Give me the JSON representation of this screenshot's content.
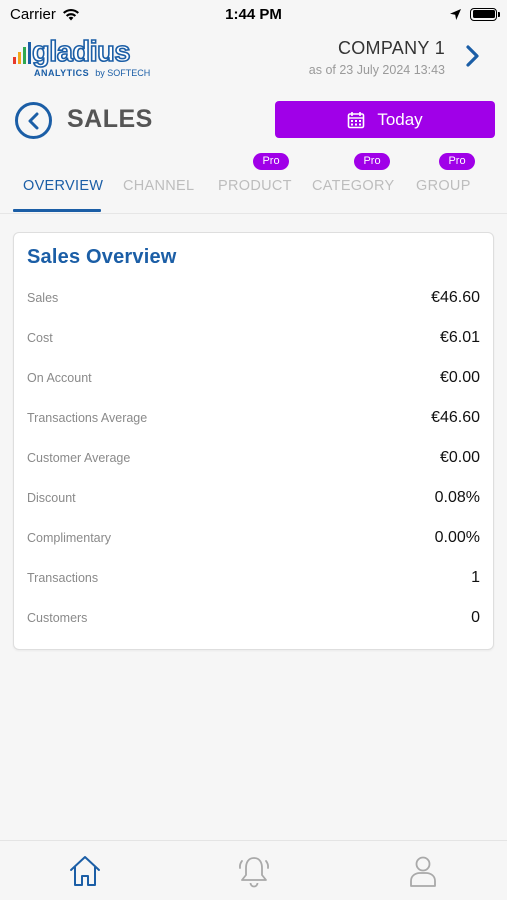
{
  "status_bar": {
    "carrier": "Carrier",
    "time": "1:44 PM"
  },
  "header": {
    "logo_word": "gladius",
    "logo_sub": "ANALYTICS",
    "logo_by": "by SOFTECH",
    "company_name": "COMPANY 1",
    "as_of": "as of 23 July 2024 13:43"
  },
  "page": {
    "title": "SALES",
    "date_button": "Today"
  },
  "tabs": [
    {
      "label": "OVERVIEW",
      "active": true,
      "pro": false
    },
    {
      "label": "CHANNEL",
      "active": false,
      "pro": false
    },
    {
      "label": "PRODUCT",
      "active": false,
      "pro": true
    },
    {
      "label": "CATEGORY",
      "active": false,
      "pro": true
    },
    {
      "label": "GROUP",
      "active": false,
      "pro": true
    }
  ],
  "pro_label": "Pro",
  "overview": {
    "title": "Sales Overview",
    "rows": [
      {
        "label": "Sales",
        "value": "€46.60"
      },
      {
        "label": "Cost",
        "value": "€6.01"
      },
      {
        "label": "On Account",
        "value": "€0.00"
      },
      {
        "label": "Transactions Average",
        "value": "€46.60"
      },
      {
        "label": "Customer Average",
        "value": "€0.00"
      },
      {
        "label": "Discount",
        "value": "0.08%"
      },
      {
        "label": "Complimentary",
        "value": "0.00%"
      },
      {
        "label": "Transactions",
        "value": "1"
      },
      {
        "label": "Customers",
        "value": "0"
      }
    ]
  },
  "bottom_nav": [
    {
      "icon": "home-icon",
      "active": true
    },
    {
      "icon": "bell-icon",
      "active": false
    },
    {
      "icon": "user-icon",
      "active": false
    }
  ],
  "colors": {
    "brand_blue": "#1b5ea6",
    "accent_purple": "#a000e8",
    "inactive_gray": "#bdbdbd"
  }
}
